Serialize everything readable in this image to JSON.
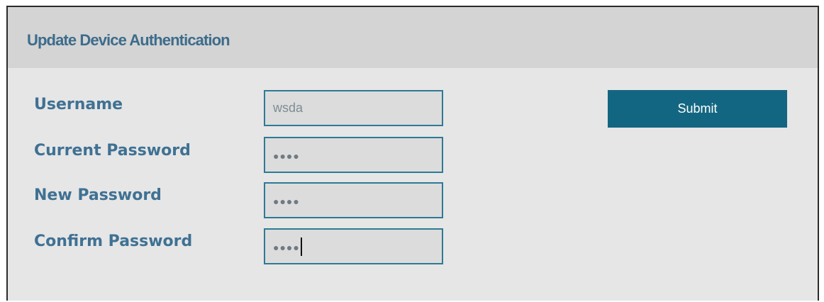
{
  "panel": {
    "title": "Update Device Authentication"
  },
  "form": {
    "username": {
      "label": "Username",
      "value": "wsda"
    },
    "current_password": {
      "label": "Current Password",
      "masked_value": "●●●●"
    },
    "new_password": {
      "label": "New Password",
      "masked_value": "●●●●"
    },
    "confirm_password": {
      "label": "Confirm Password",
      "masked_value": "●●●●"
    },
    "submit_label": "Submit"
  },
  "colors": {
    "title": "#3d6c8b",
    "label": "#3f7193",
    "input_border": "#2d7a96",
    "button": "#136681",
    "header_bg": "#d4d4d4",
    "panel_bg": "#e6e6e6"
  }
}
